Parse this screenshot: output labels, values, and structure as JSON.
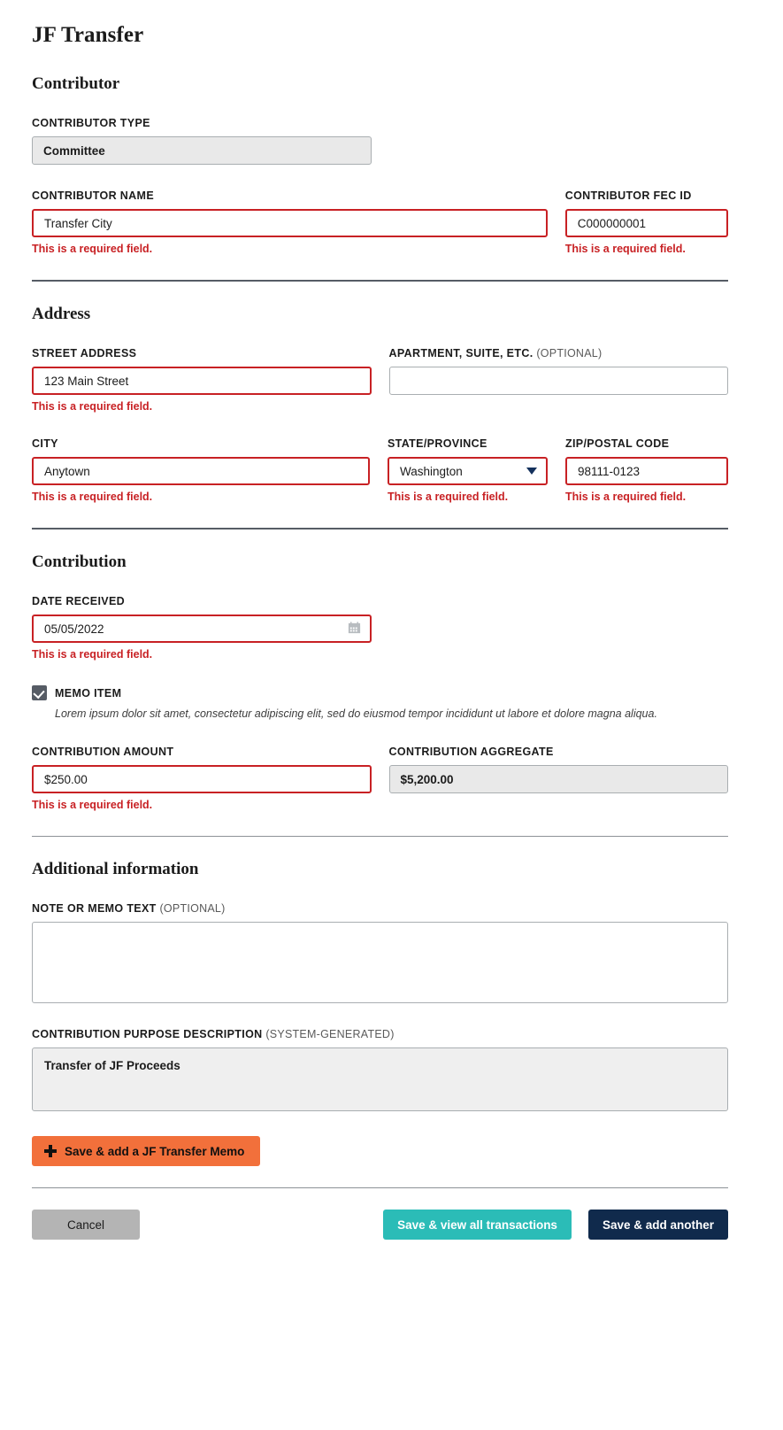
{
  "page": {
    "title": "JF Transfer"
  },
  "sections": {
    "contributor": {
      "heading": "Contributor",
      "type_label": "CONTRIBUTOR TYPE",
      "type_value": "Committee",
      "name_label": "CONTRIBUTOR NAME",
      "name_value": "Transfer City",
      "name_error": "This is a required field.",
      "fecid_label": "CONTRIBUTOR FEC ID",
      "fecid_value": "C000000001",
      "fecid_error": "This is a required field."
    },
    "address": {
      "heading": "Address",
      "street_label": "STREET ADDRESS",
      "street_value": "123 Main Street",
      "street_error": "This is a required field.",
      "apt_label": "APARTMENT, SUITE, ETC.",
      "apt_label_optional": "(OPTIONAL)",
      "apt_value": "",
      "city_label": "CITY",
      "city_value": "Anytown",
      "city_error": "This is a required field.",
      "state_label": "STATE/PROVINCE",
      "state_value": "Washington",
      "state_error": "This is a required field.",
      "zip_label": "ZIP/POSTAL CODE",
      "zip_value": "98111-0123",
      "zip_error": "This is a required field."
    },
    "contribution": {
      "heading": "Contribution",
      "date_label": "DATE RECEIVED",
      "date_value": "05/05/2022",
      "date_error": "This is a required field.",
      "memo_checkbox_label": "MEMO ITEM",
      "memo_checked": true,
      "memo_hint": "Lorem ipsum dolor sit amet, consectetur adipiscing elit, sed do eiusmod tempor incididunt ut labore et dolore magna aliqua.",
      "amount_label": "CONTRIBUTION AMOUNT",
      "amount_value": "$250.00",
      "amount_error": "This is a required field.",
      "aggregate_label": "CONTRIBUTION AGGREGATE",
      "aggregate_value": "$5,200.00"
    },
    "additional": {
      "heading": "Additional information",
      "note_label": "NOTE OR MEMO TEXT",
      "note_label_optional": "(OPTIONAL)",
      "note_value": "",
      "cpd_label": "CONTRIBUTION PURPOSE DESCRIPTION",
      "cpd_label_optional": "(SYSTEM-GENERATED)",
      "cpd_value": "Transfer of JF Proceeds"
    }
  },
  "buttons": {
    "memo": "Save & add a JF Transfer Memo",
    "cancel": "Cancel",
    "save_view_all": "Save & view all transactions",
    "save_add_another": "Save & add another"
  },
  "colors": {
    "error": "#c82124",
    "orange": "#f2703b",
    "teal": "#2bbcb7",
    "navy": "#102a4c",
    "gray": "#b4b4b4"
  }
}
